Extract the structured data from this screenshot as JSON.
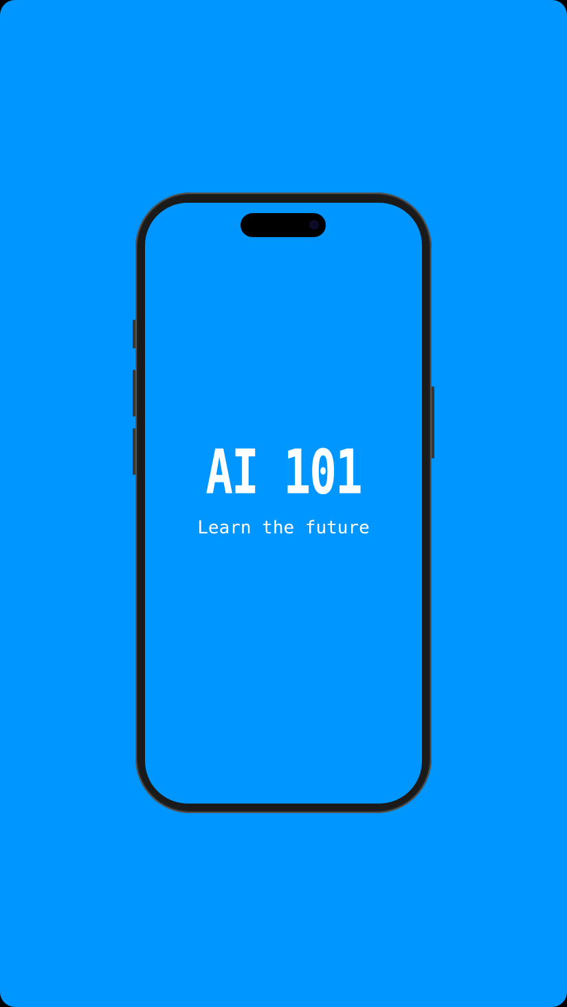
{
  "app": {
    "logo_text": "AI 101",
    "tagline": "Learn the future",
    "background_color": "#0096ff",
    "text_color": "#ffffff"
  }
}
